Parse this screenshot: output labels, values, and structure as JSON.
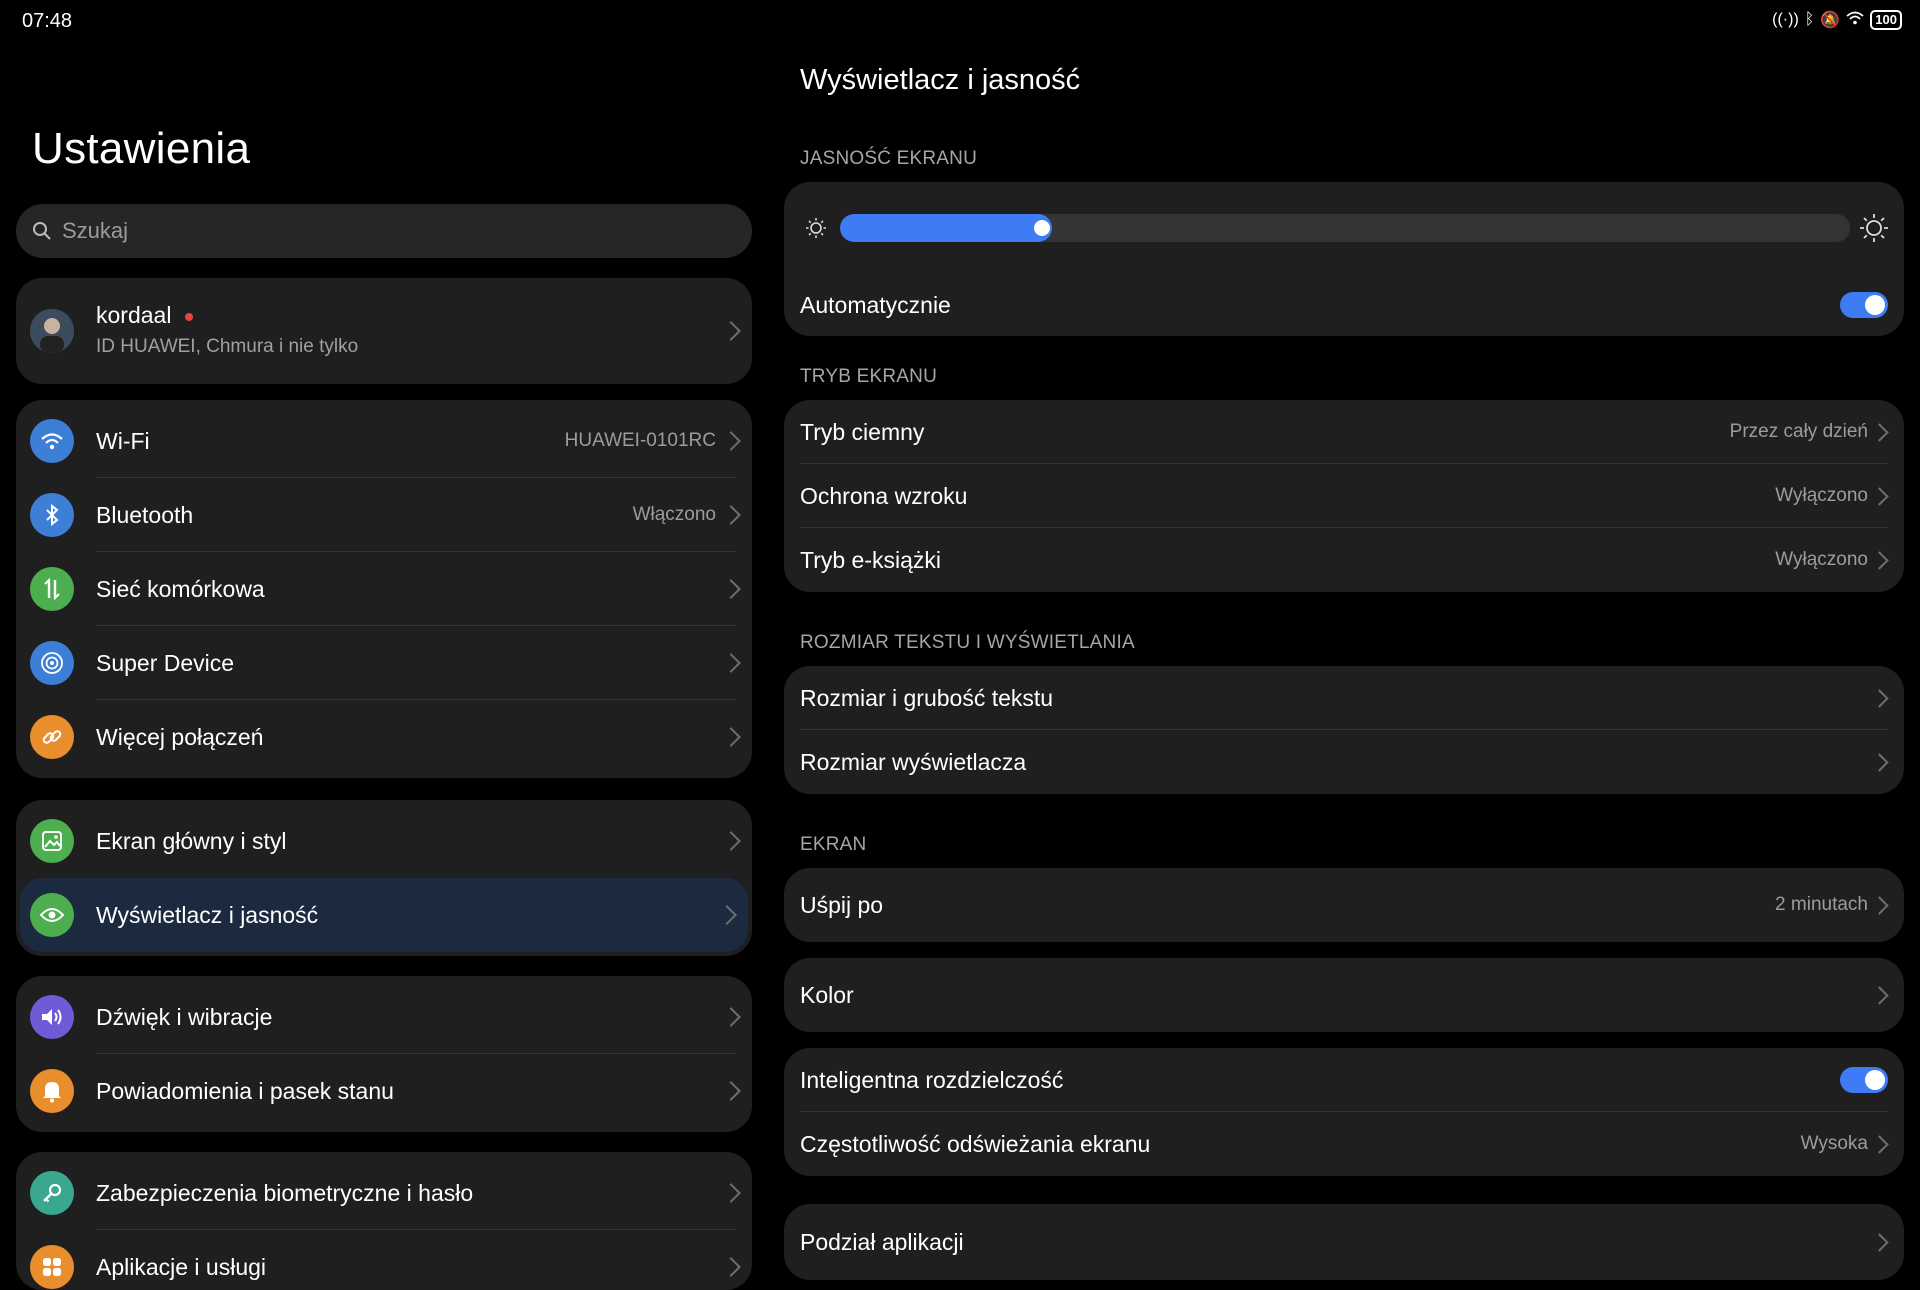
{
  "status": {
    "time": "07:48",
    "battery": "100"
  },
  "left": {
    "title": "Ustawienia",
    "search_placeholder": "Szukaj",
    "profile": {
      "name": "kordaal",
      "subtitle": "ID HUAWEI, Chmura i nie tylko"
    },
    "groups": [
      {
        "items": [
          {
            "label": "Wi-Fi",
            "value": "HUAWEI-0101RC",
            "icon": "wifi-icon",
            "color": "#3d7fd6"
          },
          {
            "label": "Bluetooth",
            "value": "Włączono",
            "icon": "bluetooth-icon",
            "color": "#3d7fd6"
          },
          {
            "label": "Sieć komórkowa",
            "value": "",
            "icon": "mobile-data-icon",
            "color": "#4cae4f"
          },
          {
            "label": "Super Device",
            "value": "",
            "icon": "super-device-icon",
            "color": "#3d7fd6"
          },
          {
            "label": "Więcej połączeń",
            "value": "",
            "icon": "link-icon",
            "color": "#e98e2c"
          }
        ]
      },
      {
        "items": [
          {
            "label": "Ekran główny i styl",
            "icon": "image-icon",
            "color": "#4cae4f"
          },
          {
            "label": "Wyświetlacz i jasność",
            "icon": "eye-icon",
            "color": "#4cae4f"
          }
        ]
      },
      {
        "items": [
          {
            "label": "Dźwięk i wibracje",
            "icon": "sound-icon",
            "color": "#6f5bd6"
          },
          {
            "label": "Powiadomienia i pasek stanu",
            "icon": "bell-icon",
            "color": "#e98e2c"
          }
        ]
      },
      {
        "items": [
          {
            "label": "Zabezpieczenia biometryczne i hasło",
            "icon": "key-icon",
            "color": "#3aa88e"
          },
          {
            "label": "Aplikacje i usługi",
            "icon": "apps-icon",
            "color": "#e98e2c"
          }
        ]
      }
    ]
  },
  "right": {
    "title": "Wyświetlacz i jasność",
    "brightness": {
      "section": "JASNOŚĆ EKRANU",
      "level": 0.21,
      "auto_label": "Automatycznie",
      "auto_on": true
    },
    "screen_mode": {
      "section": "TRYB EKRANU",
      "items": [
        {
          "label": "Tryb ciemny",
          "value": "Przez cały dzień"
        },
        {
          "label": "Ochrona wzroku",
          "value": "Wyłączono"
        },
        {
          "label": "Tryb e-książki",
          "value": "Wyłączono"
        }
      ]
    },
    "text_size": {
      "section": "ROZMIAR TEKSTU I WYŚWIETLANIA",
      "items": [
        {
          "label": "Rozmiar i grubość tekstu"
        },
        {
          "label": "Rozmiar wyświetlacza"
        }
      ]
    },
    "screen": {
      "section": "EKRAN",
      "sleep_label": "Uśpij po",
      "sleep_value": "2 minutach"
    },
    "color_label": "Kolor",
    "smart": {
      "resolution_label": "Inteligentna rozdzielczość",
      "resolution_on": true,
      "refresh_label": "Częstotliwość odświeżania ekranu",
      "refresh_value": "Wysoka"
    },
    "split_label": "Podział aplikacji"
  },
  "colors": {
    "accent": "#3e7bf5",
    "card": "#1f1f1f",
    "active_row": "#1c2a3f"
  }
}
